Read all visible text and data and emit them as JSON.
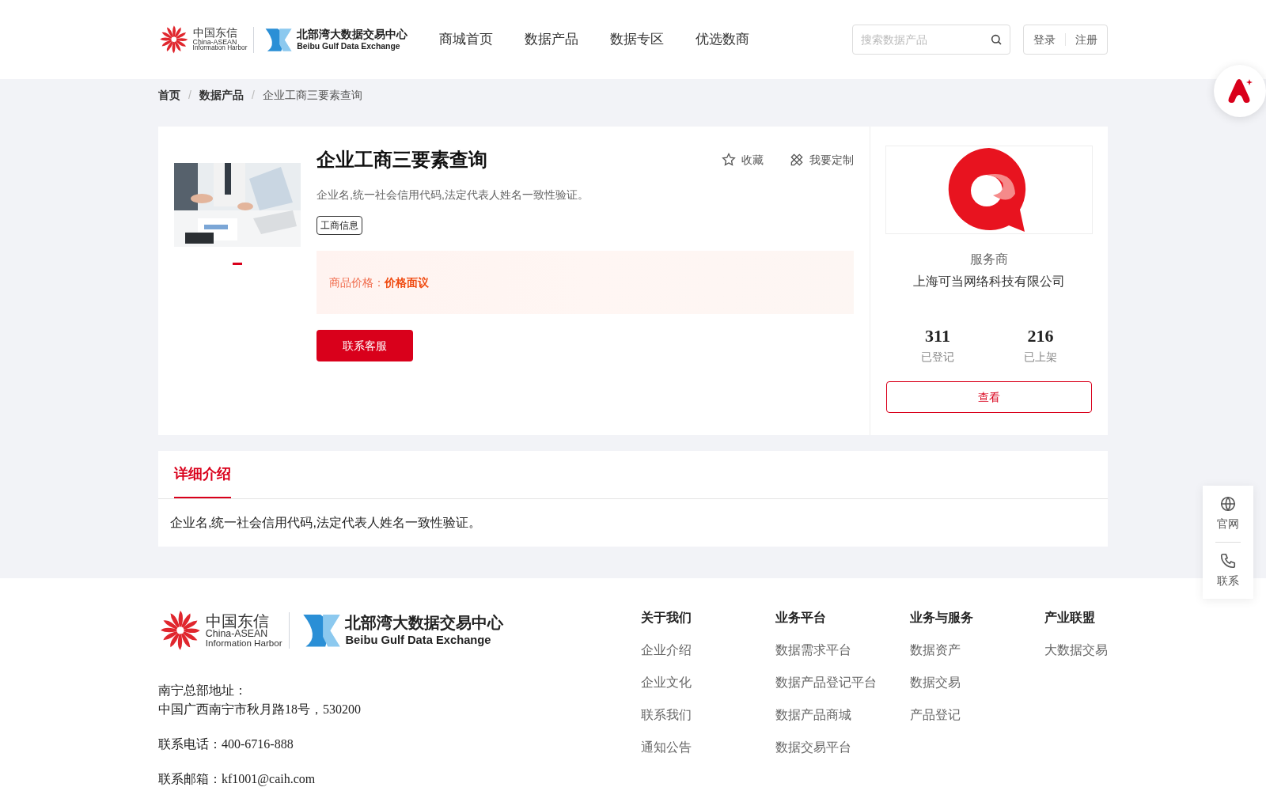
{
  "header": {
    "logo": {
      "cn_name": "中国东信",
      "en_name": "China-ASEAN",
      "en_sub": "Information Harbor",
      "exchange_cn": "北部湾大数据交易中心",
      "exchange_en": "Beibu Gulf Data Exchange"
    },
    "nav": [
      {
        "label": "商城首页",
        "selected": false
      },
      {
        "label": "数据产品",
        "selected": false
      },
      {
        "label": "数据专区",
        "selected": false
      },
      {
        "label": "优选数商",
        "selected": false
      }
    ],
    "search": {
      "placeholder": "搜索数据产品"
    },
    "auth": [
      "登录",
      "注册"
    ]
  },
  "breadcrumb": [
    {
      "label": "首页",
      "kind": "link"
    },
    {
      "label": "/",
      "kind": "separator"
    },
    {
      "label": "数据产品",
      "kind": "link"
    },
    {
      "label": "/",
      "kind": "separator"
    },
    {
      "label": "企业工商三要素查询",
      "kind": "current"
    }
  ],
  "product": {
    "title": "企业工商三要素查询",
    "description": "企业名,统一社会信用代码,法定代表人姓名一致性验证。",
    "tags": [
      "工商信息"
    ],
    "actions": [
      {
        "label": "收藏",
        "kind": "star"
      },
      {
        "label": "我要定制",
        "kind": "custom"
      }
    ],
    "price_label": "商品价格：",
    "price_value": "价格面议",
    "contact_button": "联系客服",
    "carousel": [
      {
        "selected": true
      }
    ]
  },
  "provider": {
    "role": "服务商",
    "name": "上海可当网络科技有限公司",
    "stats": [
      {
        "value": "311",
        "label": "已登记"
      },
      {
        "value": "216",
        "label": "已上架"
      }
    ],
    "view_button": "查看"
  },
  "detail": {
    "tabs": [
      {
        "label": "详细介绍",
        "selected": true
      }
    ],
    "text": "企业名,统一社会信用代码,法定代表人姓名一致性验证。"
  },
  "side_panel": [
    {
      "label": "官网",
      "kind": "globe"
    },
    {
      "label": "联系",
      "kind": "phone"
    }
  ],
  "footer": {
    "logo": {
      "cn_name": "中国东信",
      "en_name": "China-ASEAN",
      "en_sub": "Information Harbor",
      "exchange_cn": "北部湾大数据交易中心",
      "exchange_en": "Beibu Gulf Data Exchange"
    },
    "address_label": "南宁总部地址：",
    "address": "中国广西南宁市秋月路18号，530200",
    "phone": "联系电话：400-6716-888",
    "email": "联系邮箱：kf1001@caih.com",
    "columns": [
      {
        "title": "关于我们",
        "links": [
          "企业介绍",
          "企业文化",
          "联系我们",
          "通知公告"
        ]
      },
      {
        "title": "业务平台",
        "links": [
          "数据需求平台",
          "数据产品登记平台",
          "数据产品商城",
          "数据交易平台"
        ]
      },
      {
        "title": "业务与服务",
        "links": [
          "数据资产",
          "数据交易",
          "产品登记"
        ]
      },
      {
        "title": "产业联盟",
        "links": [
          "大数据交易"
        ]
      }
    ]
  }
}
